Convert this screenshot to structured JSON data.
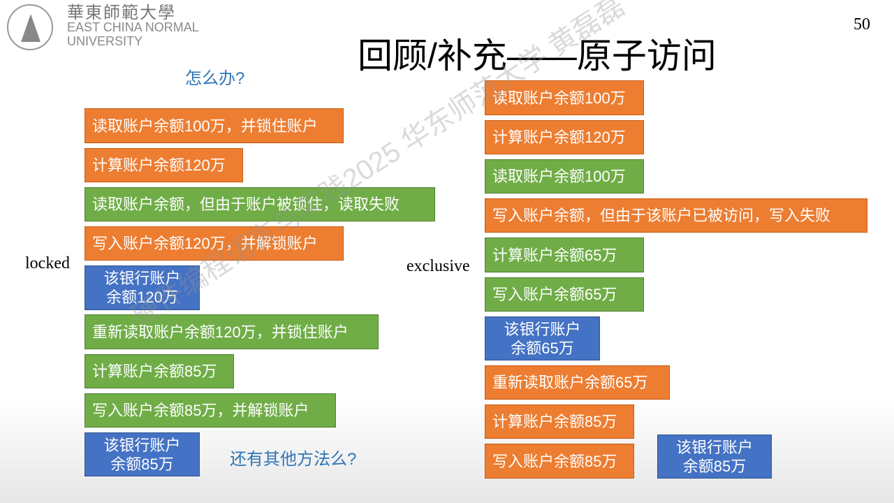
{
  "logo": {
    "cn": "華東師範大學",
    "en1": "EAST CHINA NORMAL",
    "en2": "UNIVERSITY"
  },
  "title": "回顾/补充——原子访问",
  "page_number": "50",
  "question1": "怎么办?",
  "question2": "还有其他方法么?",
  "label_locked": "locked",
  "label_exclusive": "exclusive",
  "watermark": "硬件编程语言与实践2025 华东师范大学 黄磊磊",
  "colors": {
    "orange": "#ED7D31",
    "green": "#70AD47",
    "blue": "#4472C4"
  },
  "left_steps": [
    {
      "text": "读取账户余额100万，并锁住账户",
      "color": "orange"
    },
    {
      "text": "计算账户余额120万",
      "color": "orange"
    },
    {
      "text": "读取账户余额，但由于账户被锁住，读取失败",
      "color": "green"
    },
    {
      "text": "写入账户余额120万，并解锁账户",
      "color": "orange"
    },
    {
      "line1": "该银行账户",
      "line2": "余额120万",
      "color": "blue"
    },
    {
      "text": "重新读取账户余额120万，并锁住账户",
      "color": "green"
    },
    {
      "text": "计算账户余额85万",
      "color": "green"
    },
    {
      "text": "写入账户余额85万，并解锁账户",
      "color": "green"
    },
    {
      "line1": "该银行账户",
      "line2": "余额85万",
      "color": "blue"
    }
  ],
  "right_steps": [
    {
      "text": "读取账户余额100万",
      "color": "orange"
    },
    {
      "text": "计算账户余额120万",
      "color": "orange"
    },
    {
      "text": "读取账户余额100万",
      "color": "green"
    },
    {
      "text": "写入账户余额，但由于该账户已被访问，写入失败",
      "color": "orange"
    },
    {
      "text": "计算账户余额65万",
      "color": "green"
    },
    {
      "text": "写入账户余额65万",
      "color": "green"
    },
    {
      "line1": "该银行账户",
      "line2": "余额65万",
      "color": "blue"
    },
    {
      "text": "重新读取账户余额65万",
      "color": "orange"
    },
    {
      "text": "计算账户余额85万",
      "color": "orange"
    },
    {
      "text": "写入账户余额85万",
      "color": "orange"
    },
    {
      "line1": "该银行账户",
      "line2": "余额85万",
      "color": "blue"
    }
  ]
}
